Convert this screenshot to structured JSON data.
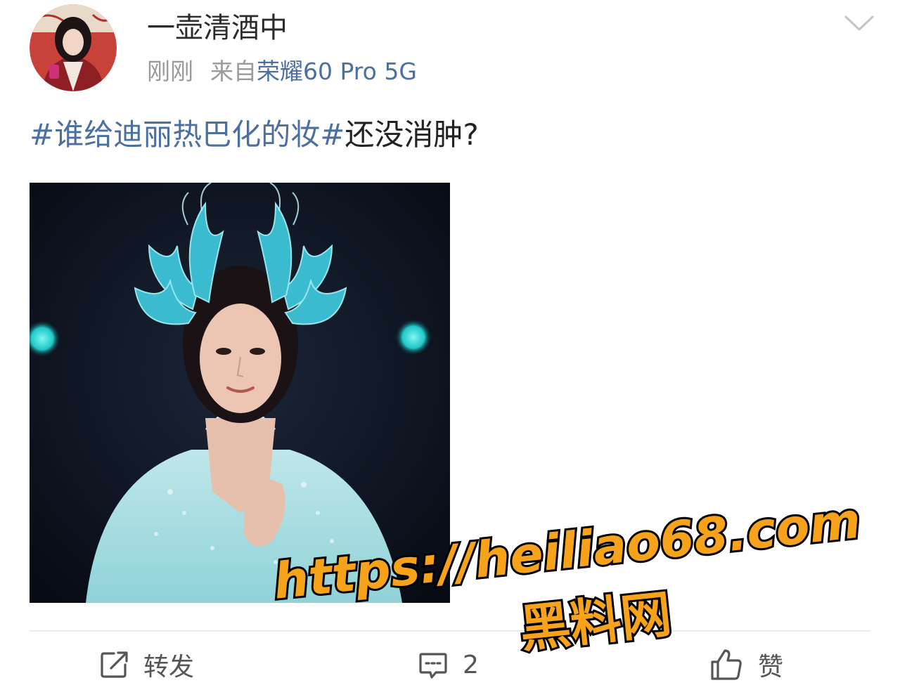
{
  "author": {
    "name": "一壶清酒中",
    "avatar_icon": "avatar-portrait"
  },
  "meta": {
    "time": "刚刚",
    "source_prefix": "来自",
    "device": "荣耀60 Pro 5G"
  },
  "post": {
    "hashtag": "#谁给迪丽热巴化的妆#",
    "text": "还没消肿?",
    "image_icon": "photo-performer-blue-costume"
  },
  "actions": {
    "repost_label": "转发",
    "comment_count": "2",
    "like_label": "赞"
  },
  "watermark": {
    "line1": "https://heiliao68.com",
    "line2": "黑料网"
  },
  "colors": {
    "link_blue": "#4a6fa0",
    "meta_gray": "#9a9a9a",
    "watermark_fill": "#f7a21b",
    "watermark_stroke": "#000000"
  }
}
